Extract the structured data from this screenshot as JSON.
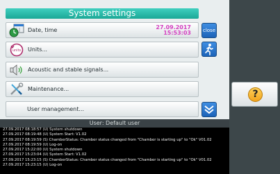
{
  "header": {
    "title": "System settings"
  },
  "clock": {
    "date": "27.09.2017",
    "time": "15:53:03"
  },
  "menu": {
    "items": [
      {
        "label": "Date, time",
        "icon": "calendar-clock-icon"
      },
      {
        "label": "Units...",
        "icon": "units-icon",
        "icon_text": "units"
      },
      {
        "label": "Acoustic and stable signals...",
        "icon": "speaker-icon"
      },
      {
        "label": "Maintenance...",
        "icon": "wrench-screwdriver-icon"
      },
      {
        "label": "User management...",
        "icon": ""
      }
    ]
  },
  "buttons": {
    "close_label": "close",
    "help_icon": "question-mark-icon",
    "help_glyph": "?"
  },
  "user_bar": {
    "text": "User: Default user"
  },
  "log": {
    "lines": [
      "27.09.2017 08:18:57 (U) System shutdown",
      "27.09.2017 08:19:48 (U) System Start: V1.02",
      "27.09.2017 08:19:59 (S) ChamberStatus: Chamber status changed from \"Chamber is starting up\" to \"Ok\" V01.02",
      "27.09.2017 08:19:59 (U) Log-on",
      "27.09.2017 15:22:00 (U) System shutdown",
      "27.09.2017 15:23:04 (U) System Start: V1.02",
      "27.09.2017 15:23:15 (S) ChamberStatus: Chamber status changed from \"Chamber is starting up\" to \"Ok\" V01.02",
      "27.09.2017 15:23:15 (U) Log-on"
    ]
  },
  "colors": {
    "title_bar": "#25b8a6",
    "clock_text": "#d43fc0",
    "button_blue": "#2a74cf",
    "help_yellow": "#f5b82e",
    "log_background": "#000000"
  }
}
